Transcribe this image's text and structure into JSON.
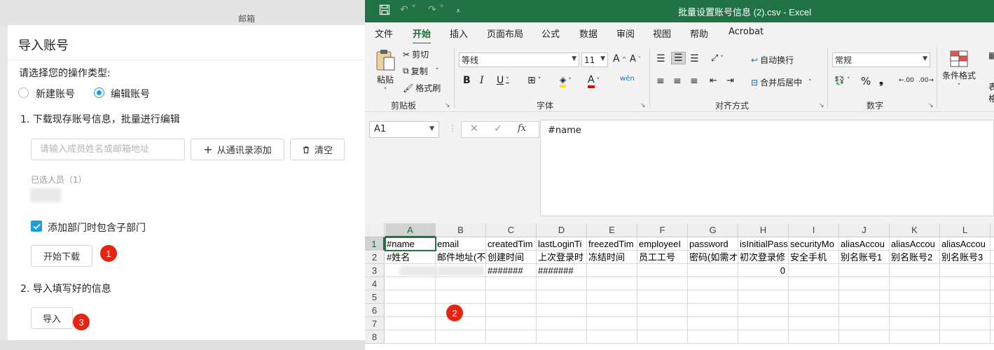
{
  "background": {
    "header_title": "邮箱"
  },
  "dialog": {
    "title": "导入账号",
    "operation_prompt": "请选择您的操作类型:",
    "radio_new": "新建账号",
    "radio_edit": "编辑账号",
    "selected_radio": "编辑账号",
    "step1_title": "1. 下载现存账号信息，批量进行编辑",
    "search_placeholder": "请输入成员姓名或邮箱地址",
    "add_from_contacts": "从通讯录添加",
    "clear_label": "清空",
    "selected_members": "已选人员（1）",
    "include_subdept_label": "添加部门时包含子部门",
    "include_subdept_checked": true,
    "download_button": "开始下载",
    "step2_title": "2. 导入填写好的信息",
    "import_button": "导入",
    "badges": [
      "1",
      "2",
      "3"
    ]
  },
  "excel": {
    "title": "批量设置账号信息 (2).csv  -  Excel",
    "tabs": [
      "文件",
      "开始",
      "插入",
      "页面布局",
      "公式",
      "数据",
      "审阅",
      "视图",
      "帮助",
      "Acrobat"
    ],
    "active_tab": "开始",
    "ribbon": {
      "paste": "粘贴",
      "cut": "剪切",
      "copy": "复制",
      "format_painter": "格式刷",
      "clipboard_group": "剪贴板",
      "font_name": "等线",
      "font_size": "11",
      "font_group": "字体",
      "wrap_text": "自动换行",
      "merge_center": "合并后居中",
      "alignment_group": "对齐方式",
      "number_format": "常规",
      "number_group": "数字",
      "conditional_format": "条件格式",
      "table_format_partial": "表格"
    },
    "name_box": "A1",
    "formula_content": "#name",
    "columns": [
      "A",
      "B",
      "C",
      "D",
      "E",
      "F",
      "G",
      "H",
      "I",
      "J",
      "K",
      "L"
    ],
    "rows": [
      "1",
      "2",
      "3",
      "4",
      "5",
      "6",
      "7",
      "8"
    ],
    "row1": [
      "#name",
      "email",
      "createdTim",
      "lastLoginTi",
      "freezedTim",
      "employeeI",
      "password",
      "isInitialPass",
      "securityMo",
      "aliasAccou",
      "aliasAccou",
      "aliasAccou"
    ],
    "row2": [
      "#姓名",
      "邮件地址(不",
      "创建时间",
      "上次登录时",
      "冻结时间",
      "员工工号",
      "密码(如需オ",
      "初次登录修",
      "安全手机",
      "别名账号1",
      "别名账号2",
      "别名账号3"
    ],
    "row3": [
      "",
      "",
      "#######",
      "#######",
      "",
      "",
      "",
      "0",
      "",
      "",
      "",
      ""
    ]
  }
}
